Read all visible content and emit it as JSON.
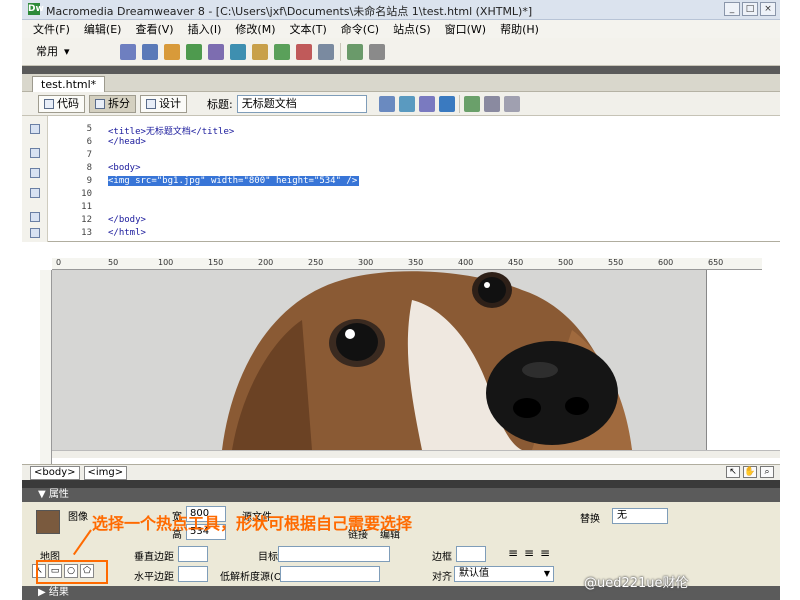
{
  "window": {
    "title": "Macromedia Dreamweaver 8 - [C:\\Users\\jxf\\Documents\\未命名站点 1\\test.html (XHTML)*]",
    "controls": [
      "_",
      "□",
      "×"
    ]
  },
  "menu": {
    "items": [
      "文件(F)",
      "编辑(E)",
      "查看(V)",
      "插入(I)",
      "修改(M)",
      "文本(T)",
      "命令(C)",
      "站点(S)",
      "窗口(W)",
      "帮助(H)"
    ]
  },
  "insert_bar": {
    "category": "常用"
  },
  "tab": {
    "label": "test.html*"
  },
  "doc_toolbar": {
    "code_label": "代码",
    "split_label": "拆分",
    "design_label": "设计",
    "title_label": "标题:",
    "title_value": "无标题文档"
  },
  "code": {
    "line_numbers": [
      "5",
      "6",
      "7",
      "8",
      "9",
      "10",
      "11",
      "12",
      "13"
    ],
    "lines": [
      "<title>无标题文档</title>",
      "</head>",
      "",
      "<body>",
      "<img src=\"bg1.jpg\" width=\"800\" height=\"534\" />",
      "",
      "",
      "</body>",
      "</html>"
    ],
    "highlighted_line": "<img src=\"bg1.jpg\" width=\"800\" height=\"534\" />"
  },
  "ruler": {
    "labels": [
      "0",
      "50",
      "100",
      "150",
      "200",
      "250",
      "300",
      "350",
      "400",
      "450",
      "500",
      "550",
      "600",
      "650"
    ]
  },
  "status": {
    "tags": [
      "<body>",
      "<img>"
    ]
  },
  "properties": {
    "header": "▼ 属性",
    "image_label": "图像",
    "width_label": "宽",
    "width_value": "800",
    "height_label": "高",
    "height_value": "534",
    "src_label": "源文件",
    "link_label": "链接",
    "alt_label": "替换",
    "alt_value": "无",
    "edit_label": "编辑",
    "map_label": "地图",
    "vspace_label": "垂直边距",
    "hspace_label": "水平边距",
    "target_label": "目标",
    "lowsrc_label": "低解析度源(O)",
    "border_label": "边框",
    "align_label": "对齐",
    "align_value": "默认值"
  },
  "annotation": {
    "text": "选择一个热点工具，形状可根据自己需要选择"
  },
  "effects": {
    "label": "▶ 结果"
  },
  "watermark": {
    "text": "@ued221ue财伦"
  }
}
